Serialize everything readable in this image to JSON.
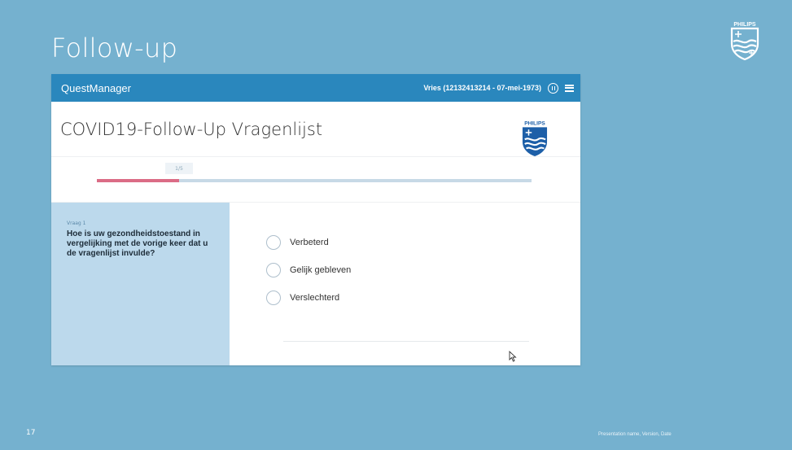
{
  "slide": {
    "title": "Follow-up",
    "number": "17",
    "footer": "Presentation name, Version, Date",
    "logo_text": "PHILIPS"
  },
  "app": {
    "name": "QuestManager",
    "patient": "Vries (12132413214 - 07-mei-1973)",
    "form_title": "COVID19-Follow-Up Vragenlijst",
    "logo_text": "PHILIPS",
    "progress": {
      "label": "1/5",
      "fraction": 0.19
    },
    "question": {
      "number_label": "Vraag 1",
      "text": "Hoe is uw gezondheidstoestand in vergelijking met de vorige keer dat u de vragenlijst invulde?",
      "options": [
        {
          "label": "Verbeterd"
        },
        {
          "label": "Gelijk gebleven"
        },
        {
          "label": "Verslechterd"
        }
      ]
    }
  },
  "colors": {
    "slide_background": "#75b1cf",
    "header": "#2a87bd",
    "progress_fill": "#db6c86",
    "question_panel": "#bcd9ec"
  },
  "icons": [
    "philips-shield-icon",
    "pause-icon",
    "menu-icon",
    "cursor-icon"
  ]
}
